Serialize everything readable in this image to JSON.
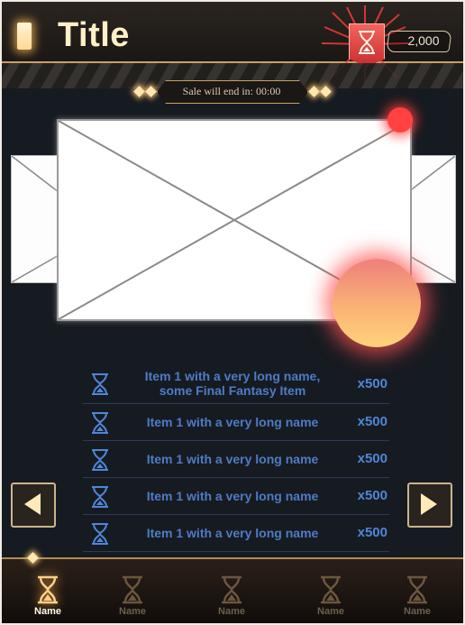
{
  "header": {
    "title": "Title",
    "currency_icon": "hourglass-icon",
    "currency_value": "2,000"
  },
  "sale": {
    "text": "Sale will end in: 00:00"
  },
  "carousel": {
    "prev_icon": "arrow-left-icon",
    "next_icon": "arrow-right-icon"
  },
  "items": [
    {
      "name": "Item 1 with a very long name, some Final Fantasy Item",
      "qty": "x500"
    },
    {
      "name": "Item 1 with a very long name",
      "qty": "x500"
    },
    {
      "name": "Item 1 with a very long name",
      "qty": "x500"
    },
    {
      "name": "Item 1 with a very long name",
      "qty": "x500"
    },
    {
      "name": "Item 1 with a very long name",
      "qty": "x500"
    }
  ],
  "nav": {
    "tabs": [
      {
        "label": "Name",
        "active": true
      },
      {
        "label": "Name",
        "active": false
      },
      {
        "label": "Name",
        "active": false
      },
      {
        "label": "Name",
        "active": false
      },
      {
        "label": "Name",
        "active": false
      }
    ]
  },
  "colors": {
    "background": "#161b21",
    "accent_gold": "#c9a068",
    "item_text": "#4f7bc6",
    "notification": "#ff4141"
  }
}
